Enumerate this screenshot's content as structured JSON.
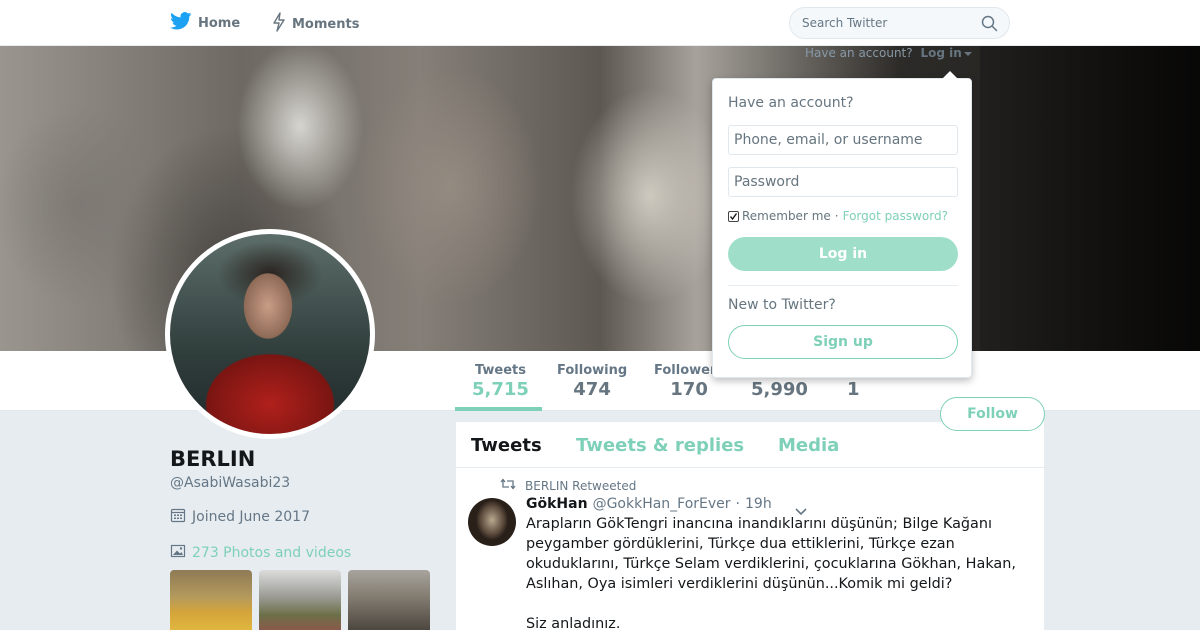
{
  "nav": {
    "home_label": "Home",
    "moments_label": "Moments",
    "search_placeholder": "Search Twitter",
    "have_account": "Have an account?",
    "login_link": "Log in"
  },
  "login_dropdown": {
    "heading": "Have an account?",
    "username_placeholder": "Phone, email, or username",
    "password_placeholder": "Password",
    "remember_label": "Remember me",
    "separator": "·",
    "forgot_label": "Forgot password?",
    "login_button": "Log in",
    "new_heading": "New to Twitter?",
    "signup_button": "Sign up"
  },
  "stats": [
    {
      "label": "Tweets",
      "value": "5,715",
      "active": true
    },
    {
      "label": "Following",
      "value": "474"
    },
    {
      "label": "Followers",
      "value": "170"
    },
    {
      "label": "",
      "value": "5,990"
    },
    {
      "label": "",
      "value": "1"
    }
  ],
  "follow_button": "Follow",
  "profile": {
    "name": "BERLIN",
    "handle": "@AsabiWasabi23",
    "joined": "Joined June 2017",
    "photos": "273 Photos and videos"
  },
  "timeline": {
    "tabs": [
      "Tweets",
      "Tweets & replies",
      "Media"
    ]
  },
  "tweet": {
    "retweeted_by": "BERLIN Retweeted",
    "name": "GökHan",
    "handle": "@GokkHan_ForEver",
    "dot": "·",
    "time": "19h",
    "body_1": "Arapların GökTengri inancına inandıklarını düşünün; Bilge Kağanı peygamber gördüklerini, Türkçe dua ettiklerini, Türkçe ezan okuduklarını, Türkçe Selam verdiklerini, çocuklarına Gökhan, Hakan, Aslıhan, Oya isimleri verdiklerini düşünün...Komik mi geldi?",
    "body_2": "Siz anladınız."
  },
  "colors": {
    "accent": "#7ed0b8",
    "accent_light": "#9fdfca",
    "text_secondary": "#657786",
    "background": "#e6ecf0"
  }
}
